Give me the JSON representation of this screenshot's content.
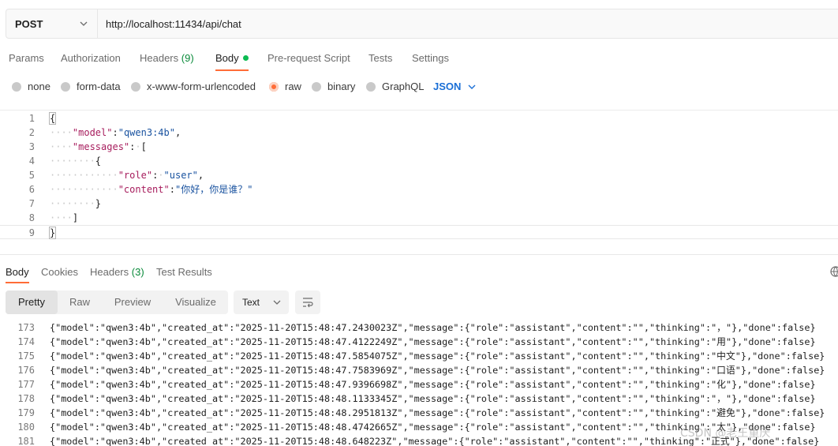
{
  "request": {
    "method": "POST",
    "url": "http://localhost:11434/api/chat"
  },
  "request_tabs": [
    {
      "label": "Params"
    },
    {
      "label": "Authorization"
    },
    {
      "label": "Headers",
      "count": "(9)"
    },
    {
      "label": "Body",
      "active": true
    },
    {
      "label": "Pre-request Script"
    },
    {
      "label": "Tests"
    },
    {
      "label": "Settings"
    }
  ],
  "body_types": [
    {
      "label": "none"
    },
    {
      "label": "form-data"
    },
    {
      "label": "x-www-form-urlencoded"
    },
    {
      "label": "raw",
      "selected": true
    },
    {
      "label": "binary"
    },
    {
      "label": "GraphQL"
    }
  ],
  "body_language": "JSON",
  "editor": {
    "line_numbers": [
      "1",
      "2",
      "3",
      "4",
      "5",
      "6",
      "7",
      "8",
      "9"
    ],
    "model_key": "\"model\"",
    "model_value": "\"qwen3:4b\"",
    "messages_key": "\"messages\"",
    "role_key": "\"role\"",
    "role_value": "\"user\"",
    "content_key": "\"content\"",
    "content_value": "\"你好，你是谁？\""
  },
  "response_tabs": [
    {
      "label": "Body",
      "active": true
    },
    {
      "label": "Cookies"
    },
    {
      "label": "Headers",
      "count": "(3)"
    },
    {
      "label": "Test Results"
    }
  ],
  "view_modes": [
    "Pretty",
    "Raw",
    "Preview",
    "Visualize"
  ],
  "active_view": "Pretty",
  "format": "Text",
  "response_lines": [
    {
      "n": "173",
      "text": "{\"model\":\"qwen3:4b\",\"created_at\":\"2025-11-20T15:48:47.2430023Z\",\"message\":{\"role\":\"assistant\",\"content\":\"\",\"thinking\":\"，\"},\"done\":false}"
    },
    {
      "n": "174",
      "text": "{\"model\":\"qwen3:4b\",\"created_at\":\"2025-11-20T15:48:47.4122249Z\",\"message\":{\"role\":\"assistant\",\"content\":\"\",\"thinking\":\"用\"},\"done\":false}"
    },
    {
      "n": "175",
      "text": "{\"model\":\"qwen3:4b\",\"created_at\":\"2025-11-20T15:48:47.5854075Z\",\"message\":{\"role\":\"assistant\",\"content\":\"\",\"thinking\":\"中文\"},\"done\":false}"
    },
    {
      "n": "176",
      "text": "{\"model\":\"qwen3:4b\",\"created_at\":\"2025-11-20T15:48:47.7583969Z\",\"message\":{\"role\":\"assistant\",\"content\":\"\",\"thinking\":\"口语\"},\"done\":false}"
    },
    {
      "n": "177",
      "text": "{\"model\":\"qwen3:4b\",\"created_at\":\"2025-11-20T15:48:47.9396698Z\",\"message\":{\"role\":\"assistant\",\"content\":\"\",\"thinking\":\"化\"},\"done\":false}"
    },
    {
      "n": "178",
      "text": "{\"model\":\"qwen3:4b\",\"created_at\":\"2025-11-20T15:48:48.1133345Z\",\"message\":{\"role\":\"assistant\",\"content\":\"\",\"thinking\":\"，\"},\"done\":false}"
    },
    {
      "n": "179",
      "text": "{\"model\":\"qwen3:4b\",\"created_at\":\"2025-11-20T15:48:48.2951813Z\",\"message\":{\"role\":\"assistant\",\"content\":\"\",\"thinking\":\"避免\"},\"done\":false}"
    },
    {
      "n": "180",
      "text": "{\"model\":\"qwen3:4b\",\"created_at\":\"2025-11-20T15:48:48.4742665Z\",\"message\":{\"role\":\"assistant\",\"content\":\"\",\"thinking\":\"太\"},\"done\":false}"
    },
    {
      "n": "181",
      "text": "{\"model\":\"qwen3:4b\",\"created_at\":\"2025-11-20T15:48:48.648223Z\",\"message\":{\"role\":\"assistant\",\"content\":\"\",\"thinking\":\"正式\"},\"done\":false}"
    }
  ],
  "watermark": "CSDN @老王重庆",
  "colors": {
    "accent": "#ff6c37",
    "status_green": "#0cbb52",
    "link_blue": "#1a6fd6"
  }
}
